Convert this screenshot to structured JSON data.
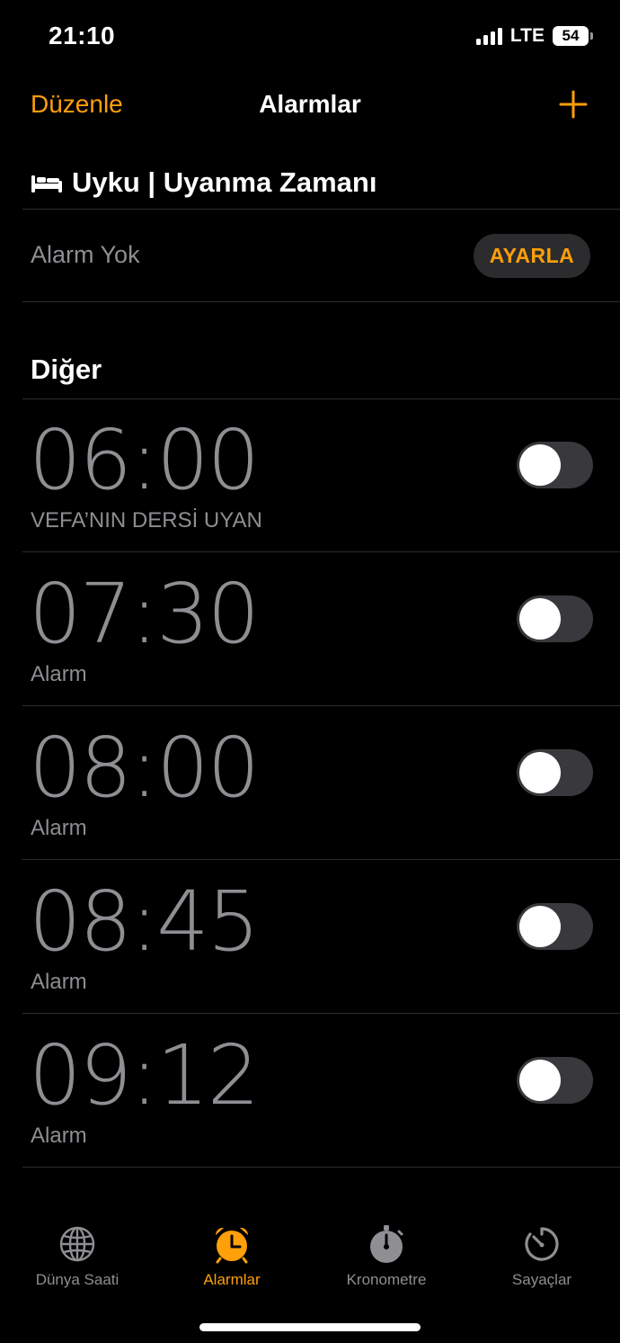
{
  "status": {
    "time": "21:10",
    "network": "LTE",
    "battery": "54"
  },
  "nav": {
    "edit_label": "Düzenle",
    "title": "Alarmlar",
    "add_icon": "plus-icon"
  },
  "sleep": {
    "header": "Uyku | Uyanma Zamanı",
    "icon": "bed-icon",
    "status": "Alarm Yok",
    "button_label": "AYARLA"
  },
  "other": {
    "header": "Diğer"
  },
  "alarms": [
    {
      "time": "06:00",
      "label": "VEFA’NIN DERSİ UYAN",
      "enabled": false
    },
    {
      "time": "07:30",
      "label": "Alarm",
      "enabled": false
    },
    {
      "time": "08:00",
      "label": "Alarm",
      "enabled": false
    },
    {
      "time": "08:45",
      "label": "Alarm",
      "enabled": false
    },
    {
      "time": "09:12",
      "label": "Alarm",
      "enabled": false
    }
  ],
  "tabs": [
    {
      "label": "Dünya Saati",
      "icon": "globe-icon",
      "active": false
    },
    {
      "label": "Alarmlar",
      "icon": "alarm-clock-icon",
      "active": true
    },
    {
      "label": "Kronometre",
      "icon": "stopwatch-icon",
      "active": false
    },
    {
      "label": "Sayaçlar",
      "icon": "timer-icon",
      "active": false
    }
  ],
  "colors": {
    "accent": "#ff9f0a",
    "background": "#000000",
    "secondary_text": "#8e8e93",
    "separator": "#2c2c2e"
  }
}
